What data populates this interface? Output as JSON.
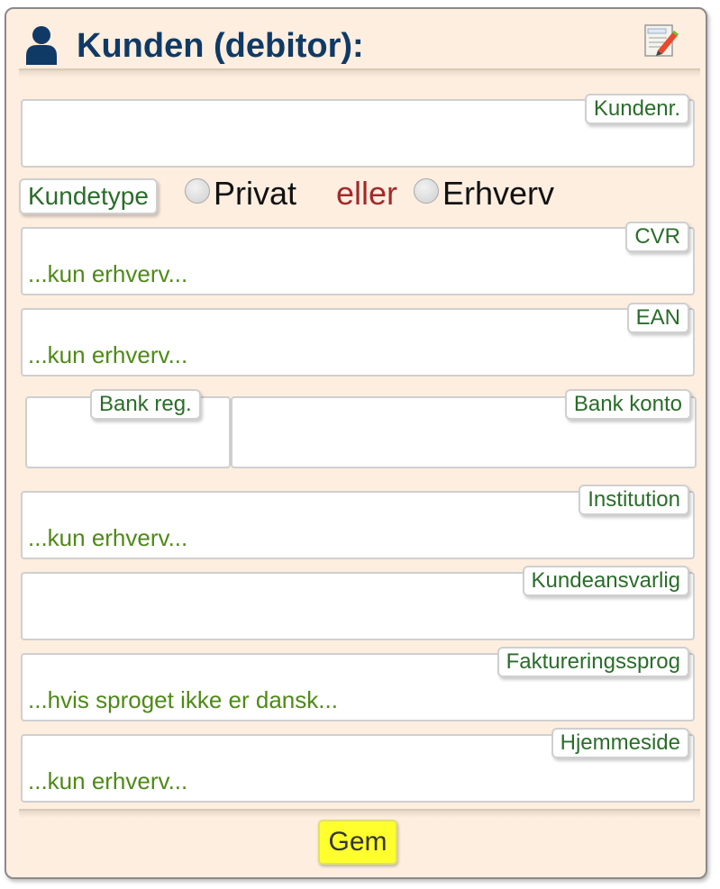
{
  "header": {
    "title": "Kunden (debitor):"
  },
  "fields": {
    "kundenr": {
      "label": "Kundenr.",
      "placeholder": ""
    },
    "kundetype": {
      "label": "Kundetype",
      "options": [
        "Privat",
        "Erhverv"
      ],
      "separator": "eller"
    },
    "cvr": {
      "label": "CVR",
      "placeholder": "...kun erhverv..."
    },
    "ean": {
      "label": "EAN",
      "placeholder": "...kun erhverv..."
    },
    "bank_reg": {
      "label": "Bank reg.",
      "placeholder": ""
    },
    "bank_konto": {
      "label": "Bank konto",
      "placeholder": ""
    },
    "institution": {
      "label": "Institution",
      "placeholder": "...kun erhverv..."
    },
    "kundeansvarlig": {
      "label": "Kundeansvarlig",
      "placeholder": ""
    },
    "faktureringssprog": {
      "label": "Faktureringssprog",
      "placeholder": "...hvis sproget ikke er dansk..."
    },
    "hjemmeside": {
      "label": "Hjemmeside",
      "placeholder": "...kun erhverv..."
    }
  },
  "buttons": {
    "save_label": "Gem"
  },
  "colors": {
    "panel_bg": "#fdeee0",
    "title": "#0f3a66",
    "label_text": "#2a6d2a",
    "placeholder_text": "#4e8a16",
    "eller_text": "#a22a2a",
    "save_button": "#ffff2e"
  },
  "icons": {
    "user": "user-icon",
    "edit": "edit-document-icon"
  }
}
